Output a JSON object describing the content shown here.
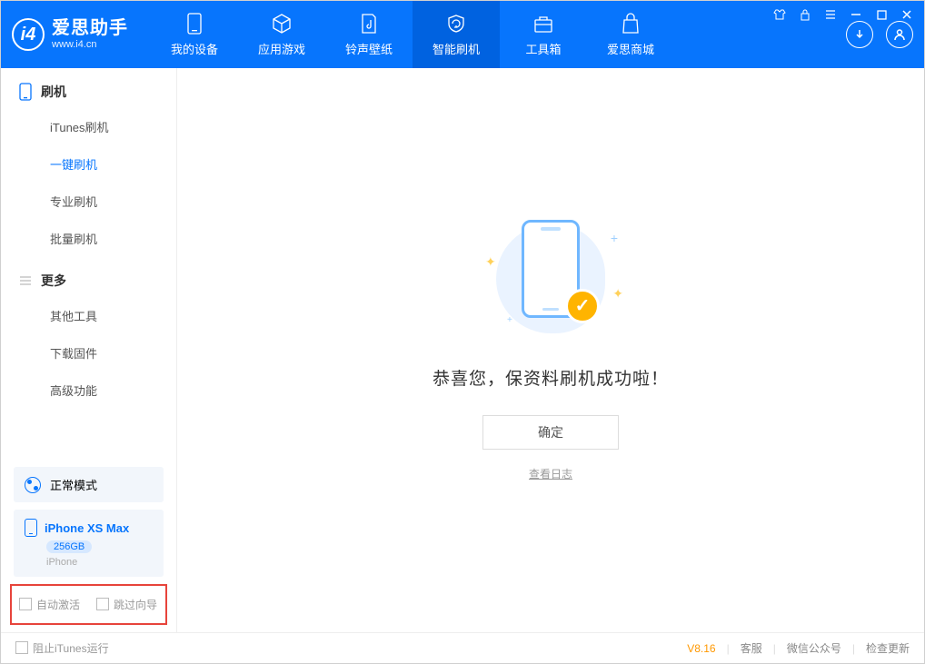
{
  "app": {
    "title": "爱思助手",
    "subtitle": "www.i4.cn"
  },
  "tabs": [
    {
      "label": "我的设备"
    },
    {
      "label": "应用游戏"
    },
    {
      "label": "铃声壁纸"
    },
    {
      "label": "智能刷机"
    },
    {
      "label": "工具箱"
    },
    {
      "label": "爱思商城"
    }
  ],
  "sidebar": {
    "section1": "刷机",
    "items1": [
      "iTunes刷机",
      "一键刷机",
      "专业刷机",
      "批量刷机"
    ],
    "section2": "更多",
    "items2": [
      "其他工具",
      "下载固件",
      "高级功能"
    ]
  },
  "mode": {
    "label": "正常模式"
  },
  "device": {
    "name": "iPhone XS Max",
    "capacity": "256GB",
    "type": "iPhone"
  },
  "options": {
    "auto_activate": "自动激活",
    "skip_wizard": "跳过向导"
  },
  "main": {
    "success_text": "恭喜您，保资料刷机成功啦！",
    "ok_button": "确定",
    "view_log": "查看日志"
  },
  "statusbar": {
    "block_itunes": "阻止iTunes运行",
    "version": "V8.16",
    "support": "客服",
    "wechat": "微信公众号",
    "update": "检查更新"
  }
}
